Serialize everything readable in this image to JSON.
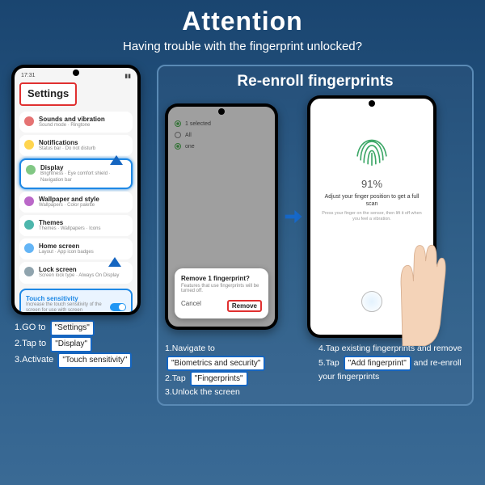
{
  "header": {
    "title": "Attention",
    "subtitle": "Having trouble with the fingerprint unlocked?"
  },
  "right_panel_title": "Re-enroll fingerprints",
  "phoneA": {
    "time": "17:31",
    "heading": "Settings",
    "items": [
      {
        "label": "Sounds and vibration",
        "desc": "Sound mode · Ringtone"
      },
      {
        "label": "Notifications",
        "desc": "Status bar · Do not disturb"
      },
      {
        "label": "Display",
        "desc": "Brightness · Eye comfort shield · Navigation bar"
      },
      {
        "label": "Wallpaper and style",
        "desc": "Wallpapers · Color palette"
      },
      {
        "label": "Themes",
        "desc": "Themes · Wallpapers · Icons"
      },
      {
        "label": "Home screen",
        "desc": "Layout · App icon badges"
      },
      {
        "label": "Lock screen",
        "desc": "Screen lock type · Always On Display"
      }
    ],
    "touch": {
      "label": "Touch sensitivity",
      "desc": "Increase the touch sensitivity of the screen for use with screen protectors."
    }
  },
  "phoneB": {
    "header": "1 selected",
    "rows": [
      "All",
      "one"
    ],
    "dialog": {
      "title": "Remove 1 fingerprint?",
      "sub": "Features that use fingerprints will be turned off.",
      "cancel": "Cancel",
      "remove": "Remove"
    }
  },
  "phoneC": {
    "percent": "91%",
    "msg": "Adjust your finger position to get a full scan",
    "sub": "Press your finger on the sensor, then lift it off when you feel a vibration."
  },
  "steps_left": [
    {
      "pre": "1.GO to",
      "pill": "\"Settings\""
    },
    {
      "pre": "2.Tap to",
      "pill": "\"Display\""
    },
    {
      "pre": "3.Activate",
      "pill": "\"Touch sensitivity\""
    }
  ],
  "steps_rA": [
    {
      "pre": "1.Navigate to",
      "pill": "\"Biometrics and security\""
    },
    {
      "pre": "2.Tap",
      "pill": "\"Fingerprints\""
    },
    {
      "pre": "3.Unlock the screen",
      "pill": ""
    }
  ],
  "steps_rB": [
    {
      "pre": "4.Tap existing fingerprints and remove",
      "pill": ""
    },
    {
      "pre": "5.Tap",
      "pill": "\"Add fingerprint\"",
      "post": "and re-enroll your fingerprints"
    }
  ]
}
